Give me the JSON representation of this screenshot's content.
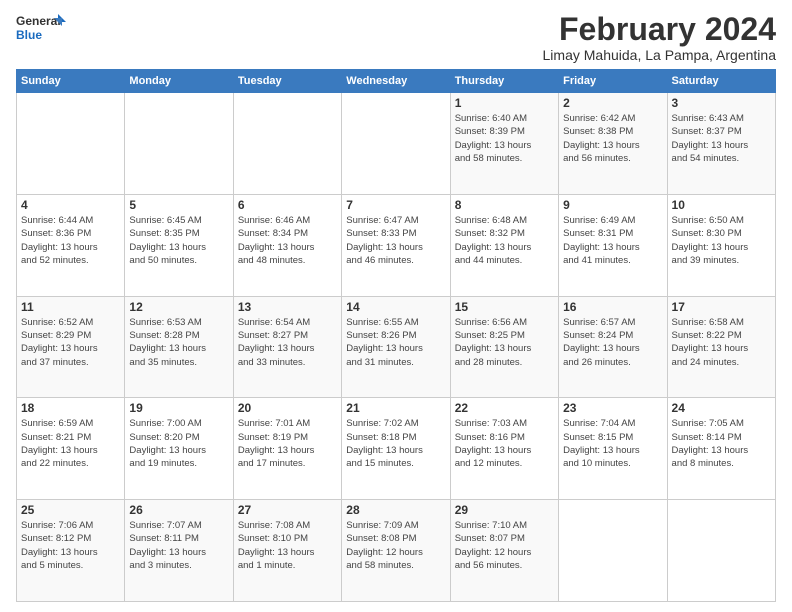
{
  "logo": {
    "line1": "General",
    "line2": "Blue"
  },
  "title": "February 2024",
  "subtitle": "Limay Mahuida, La Pampa, Argentina",
  "calendar": {
    "headers": [
      "Sunday",
      "Monday",
      "Tuesday",
      "Wednesday",
      "Thursday",
      "Friday",
      "Saturday"
    ],
    "rows": [
      [
        {
          "day": "",
          "info": ""
        },
        {
          "day": "",
          "info": ""
        },
        {
          "day": "",
          "info": ""
        },
        {
          "day": "",
          "info": ""
        },
        {
          "day": "1",
          "info": "Sunrise: 6:40 AM\nSunset: 8:39 PM\nDaylight: 13 hours\nand 58 minutes."
        },
        {
          "day": "2",
          "info": "Sunrise: 6:42 AM\nSunset: 8:38 PM\nDaylight: 13 hours\nand 56 minutes."
        },
        {
          "day": "3",
          "info": "Sunrise: 6:43 AM\nSunset: 8:37 PM\nDaylight: 13 hours\nand 54 minutes."
        }
      ],
      [
        {
          "day": "4",
          "info": "Sunrise: 6:44 AM\nSunset: 8:36 PM\nDaylight: 13 hours\nand 52 minutes."
        },
        {
          "day": "5",
          "info": "Sunrise: 6:45 AM\nSunset: 8:35 PM\nDaylight: 13 hours\nand 50 minutes."
        },
        {
          "day": "6",
          "info": "Sunrise: 6:46 AM\nSunset: 8:34 PM\nDaylight: 13 hours\nand 48 minutes."
        },
        {
          "day": "7",
          "info": "Sunrise: 6:47 AM\nSunset: 8:33 PM\nDaylight: 13 hours\nand 46 minutes."
        },
        {
          "day": "8",
          "info": "Sunrise: 6:48 AM\nSunset: 8:32 PM\nDaylight: 13 hours\nand 44 minutes."
        },
        {
          "day": "9",
          "info": "Sunrise: 6:49 AM\nSunset: 8:31 PM\nDaylight: 13 hours\nand 41 minutes."
        },
        {
          "day": "10",
          "info": "Sunrise: 6:50 AM\nSunset: 8:30 PM\nDaylight: 13 hours\nand 39 minutes."
        }
      ],
      [
        {
          "day": "11",
          "info": "Sunrise: 6:52 AM\nSunset: 8:29 PM\nDaylight: 13 hours\nand 37 minutes."
        },
        {
          "day": "12",
          "info": "Sunrise: 6:53 AM\nSunset: 8:28 PM\nDaylight: 13 hours\nand 35 minutes."
        },
        {
          "day": "13",
          "info": "Sunrise: 6:54 AM\nSunset: 8:27 PM\nDaylight: 13 hours\nand 33 minutes."
        },
        {
          "day": "14",
          "info": "Sunrise: 6:55 AM\nSunset: 8:26 PM\nDaylight: 13 hours\nand 31 minutes."
        },
        {
          "day": "15",
          "info": "Sunrise: 6:56 AM\nSunset: 8:25 PM\nDaylight: 13 hours\nand 28 minutes."
        },
        {
          "day": "16",
          "info": "Sunrise: 6:57 AM\nSunset: 8:24 PM\nDaylight: 13 hours\nand 26 minutes."
        },
        {
          "day": "17",
          "info": "Sunrise: 6:58 AM\nSunset: 8:22 PM\nDaylight: 13 hours\nand 24 minutes."
        }
      ],
      [
        {
          "day": "18",
          "info": "Sunrise: 6:59 AM\nSunset: 8:21 PM\nDaylight: 13 hours\nand 22 minutes."
        },
        {
          "day": "19",
          "info": "Sunrise: 7:00 AM\nSunset: 8:20 PM\nDaylight: 13 hours\nand 19 minutes."
        },
        {
          "day": "20",
          "info": "Sunrise: 7:01 AM\nSunset: 8:19 PM\nDaylight: 13 hours\nand 17 minutes."
        },
        {
          "day": "21",
          "info": "Sunrise: 7:02 AM\nSunset: 8:18 PM\nDaylight: 13 hours\nand 15 minutes."
        },
        {
          "day": "22",
          "info": "Sunrise: 7:03 AM\nSunset: 8:16 PM\nDaylight: 13 hours\nand 12 minutes."
        },
        {
          "day": "23",
          "info": "Sunrise: 7:04 AM\nSunset: 8:15 PM\nDaylight: 13 hours\nand 10 minutes."
        },
        {
          "day": "24",
          "info": "Sunrise: 7:05 AM\nSunset: 8:14 PM\nDaylight: 13 hours\nand 8 minutes."
        }
      ],
      [
        {
          "day": "25",
          "info": "Sunrise: 7:06 AM\nSunset: 8:12 PM\nDaylight: 13 hours\nand 5 minutes."
        },
        {
          "day": "26",
          "info": "Sunrise: 7:07 AM\nSunset: 8:11 PM\nDaylight: 13 hours\nand 3 minutes."
        },
        {
          "day": "27",
          "info": "Sunrise: 7:08 AM\nSunset: 8:10 PM\nDaylight: 13 hours\nand 1 minute."
        },
        {
          "day": "28",
          "info": "Sunrise: 7:09 AM\nSunset: 8:08 PM\nDaylight: 12 hours\nand 58 minutes."
        },
        {
          "day": "29",
          "info": "Sunrise: 7:10 AM\nSunset: 8:07 PM\nDaylight: 12 hours\nand 56 minutes."
        },
        {
          "day": "",
          "info": ""
        },
        {
          "day": "",
          "info": ""
        }
      ]
    ]
  }
}
